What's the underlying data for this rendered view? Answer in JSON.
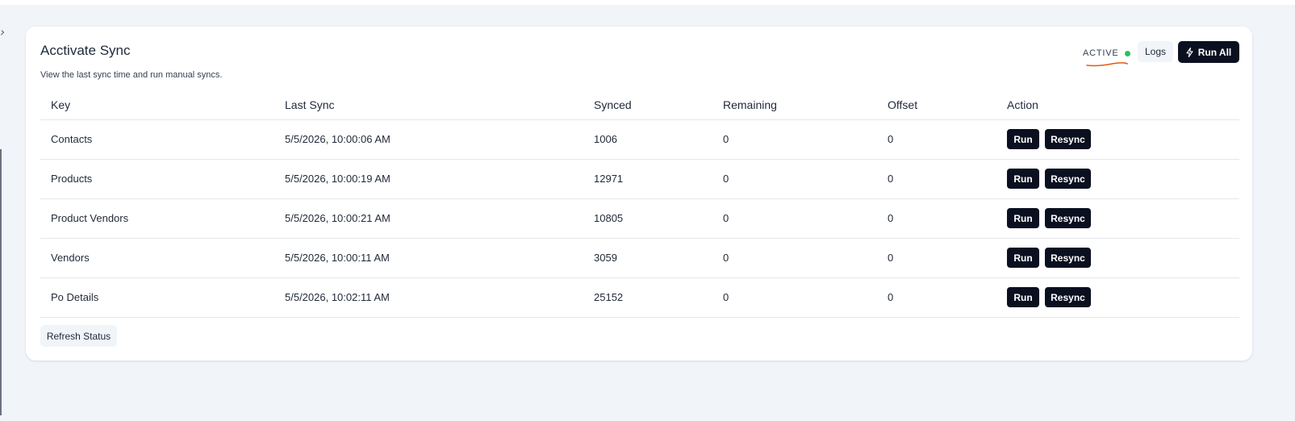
{
  "card": {
    "title": "Acctivate Sync",
    "subtitle": "View the last sync time and run manual syncs."
  },
  "header": {
    "status_label": "ACTIVE",
    "status_color": "#22c55e",
    "logs_label": "Logs",
    "run_all_label": "Run All"
  },
  "table": {
    "columns": [
      "Key",
      "Last Sync",
      "Synced",
      "Remaining",
      "Offset",
      "Action"
    ],
    "rows": [
      {
        "key": "Contacts",
        "last_sync": "5/5/2026, 10:00:06 AM",
        "synced": "1006",
        "remaining": "0",
        "offset": "0"
      },
      {
        "key": "Products",
        "last_sync": "5/5/2026, 10:00:19 AM",
        "synced": "12971",
        "remaining": "0",
        "offset": "0"
      },
      {
        "key": "Product Vendors",
        "last_sync": "5/5/2026, 10:00:21 AM",
        "synced": "10805",
        "remaining": "0",
        "offset": "0"
      },
      {
        "key": "Vendors",
        "last_sync": "5/5/2026, 10:00:11 AM",
        "synced": "3059",
        "remaining": "0",
        "offset": "0"
      },
      {
        "key": "Po Details",
        "last_sync": "5/5/2026, 10:02:11 AM",
        "synced": "25152",
        "remaining": "0",
        "offset": "0"
      }
    ],
    "run_label": "Run",
    "resync_label": "Resync"
  },
  "footer": {
    "refresh_label": "Refresh Status"
  },
  "colors": {
    "primary_button": "#0b1020",
    "secondary_button": "#f1f4f8",
    "page_background": "#f1f4f9",
    "annotation_underline": "#ea580c"
  }
}
